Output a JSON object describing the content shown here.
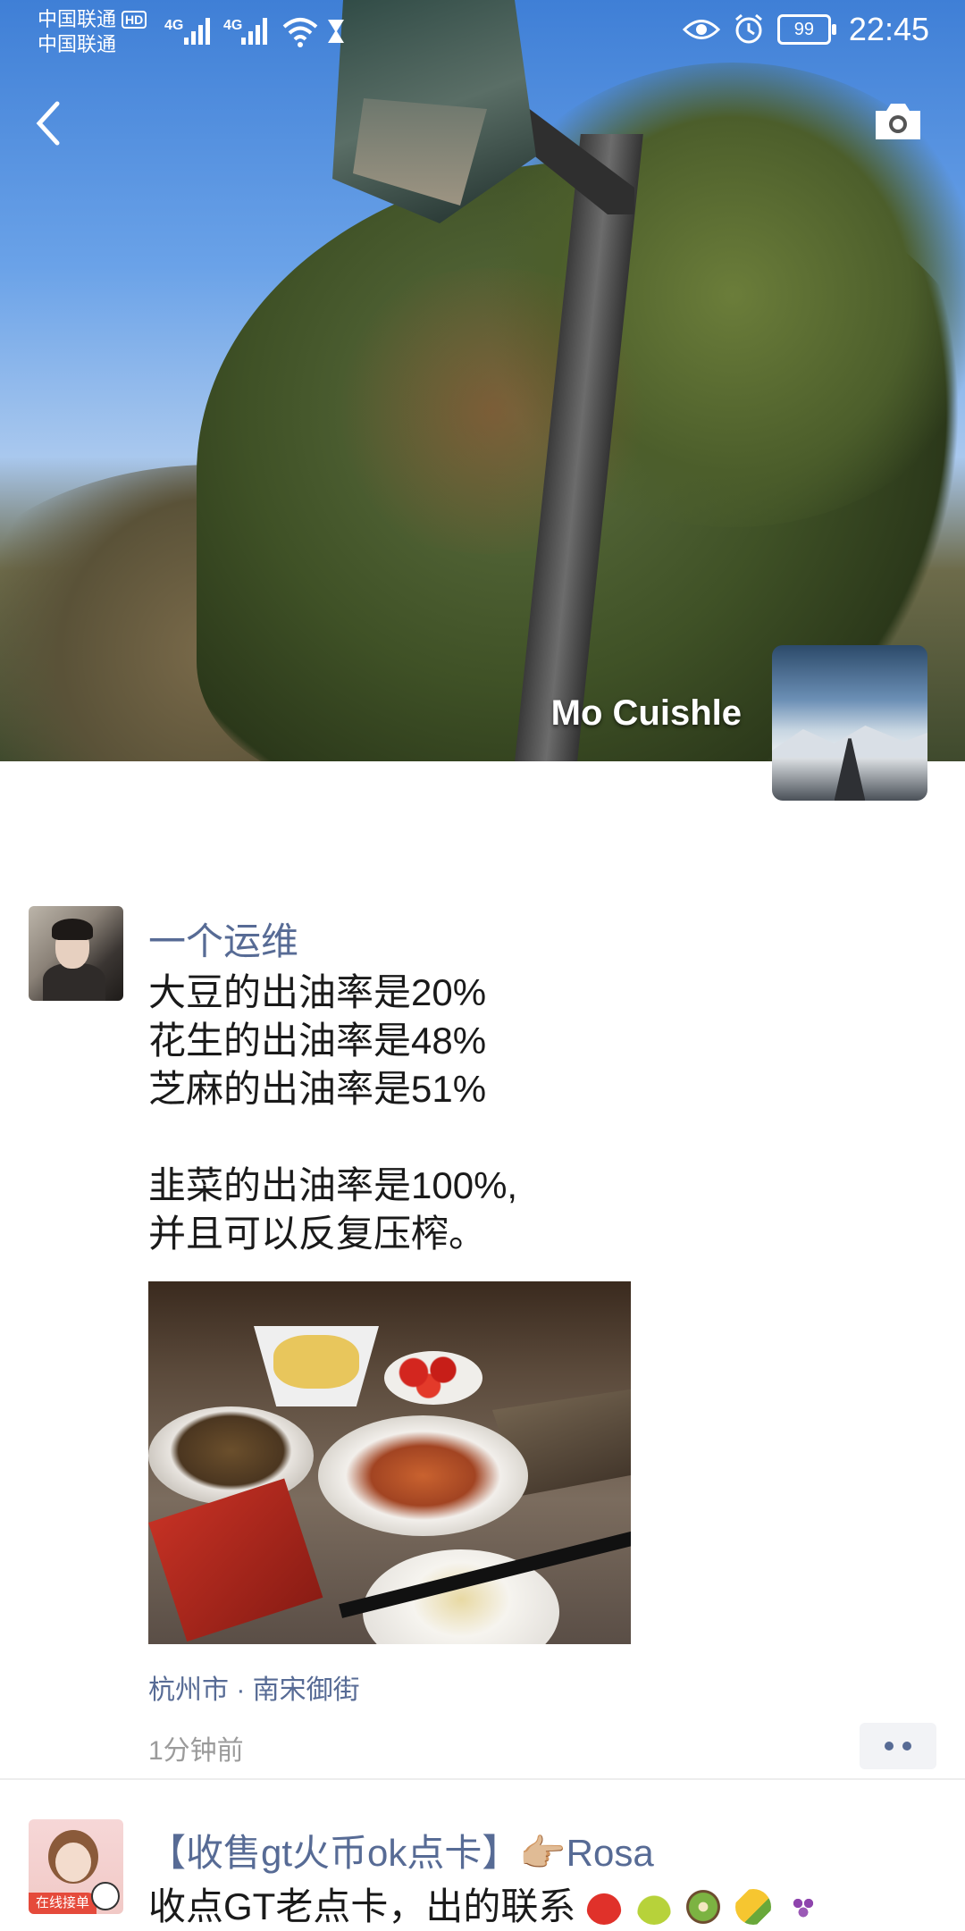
{
  "status_bar": {
    "carrier1": "中国联通",
    "carrier1_badge": "HD",
    "carrier2": "中国联通",
    "net1": "4G",
    "net2": "4G",
    "battery": "99",
    "time": "22:45"
  },
  "profile": {
    "username": "Mo Cuishle"
  },
  "post": {
    "author": "一个运维",
    "lines": [
      "大豆的出油率是20%",
      "花生的出油率是48%",
      "芝麻的出油率是51%",
      "",
      "韭菜的出油率是100%,",
      "并且可以反复压榨。"
    ],
    "location": "杭州市 · 南宋御街",
    "time": "1分钟前"
  },
  "post2": {
    "author": "【收售gt火币ok点卡】👉🏼Rosa",
    "avatar_tag": "在线接单",
    "content": "收点GT老点卡，出的联系",
    "emojis": [
      "strawberry-icon",
      "pear-icon",
      "kiwi-icon",
      "corn-icon",
      "grapes-icon"
    ]
  },
  "colors": {
    "link_blue": "#576b95",
    "meta_gray": "#9b9b9b",
    "text": "#1a1a1a"
  }
}
